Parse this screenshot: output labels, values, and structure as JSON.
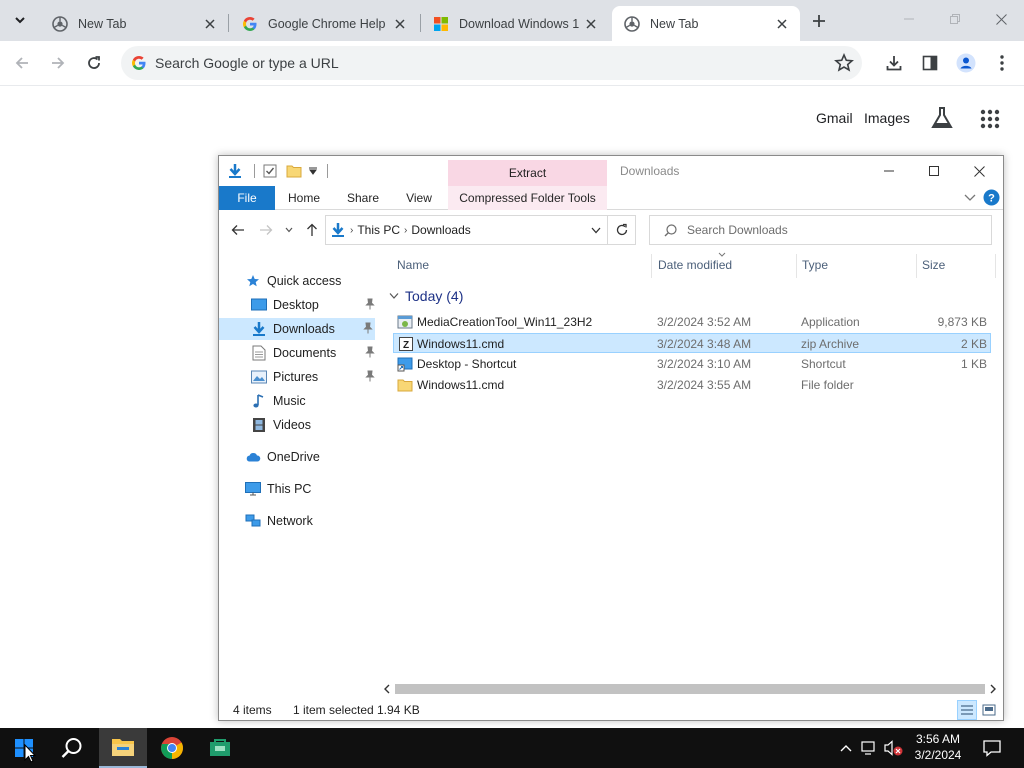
{
  "browser": {
    "tabs": [
      {
        "title": "New Tab",
        "favicon": "chrome-icon",
        "active": false
      },
      {
        "title": "Google Chrome Help",
        "favicon": "google-icon",
        "active": false
      },
      {
        "title": "Download Windows 1",
        "favicon": "microsoft-icon",
        "active": false
      },
      {
        "title": "New Tab",
        "favicon": "chrome-icon",
        "active": true
      }
    ],
    "omnibox_placeholder": "Search Google or type a URL",
    "ntp": {
      "gmail_label": "Gmail",
      "images_label": "Images"
    }
  },
  "explorer": {
    "title": "Downloads",
    "context_tab_header": "Extract",
    "ribbon_tabs": {
      "file": "File",
      "home": "Home",
      "share": "Share",
      "view": "View",
      "context": "Compressed Folder Tools"
    },
    "breadcrumb": [
      "This PC",
      "Downloads"
    ],
    "search_placeholder": "Search Downloads",
    "nav": {
      "quick_access": "Quick access",
      "desktop": "Desktop",
      "downloads": "Downloads",
      "documents": "Documents",
      "pictures": "Pictures",
      "music": "Music",
      "videos": "Videos",
      "onedrive": "OneDrive",
      "this_pc": "This PC",
      "network": "Network"
    },
    "columns": {
      "name": "Name",
      "date": "Date modified",
      "type": "Type",
      "size": "Size"
    },
    "group_header": "Today (4)",
    "files": [
      {
        "name": "MediaCreationTool_Win11_23H2",
        "date": "3/2/2024 3:52 AM",
        "type": "Application",
        "size": "9,873 KB",
        "icon": "application-icon",
        "selected": false
      },
      {
        "name": "Windows11.cmd",
        "date": "3/2/2024 3:48 AM",
        "type": "zip Archive",
        "size": "2 KB",
        "icon": "zip-archive-icon",
        "selected": true
      },
      {
        "name": "Desktop - Shortcut",
        "date": "3/2/2024 3:10 AM",
        "type": "Shortcut",
        "size": "1 KB",
        "icon": "shortcut-icon",
        "selected": false
      },
      {
        "name": "Windows11.cmd",
        "date": "3/2/2024 3:55 AM",
        "type": "File folder",
        "size": "",
        "icon": "folder-icon",
        "selected": false
      }
    ],
    "status": {
      "items": "4 items",
      "selected": "1 item selected",
      "size": "1.94 KB"
    }
  },
  "taskbar": {
    "time": "3:56 AM",
    "date": "3/2/2024"
  },
  "colors": {
    "accent": "#1979ca",
    "selection": "#cce8ff",
    "context_tab": "#f9d7e4",
    "taskbar": "#101010"
  }
}
